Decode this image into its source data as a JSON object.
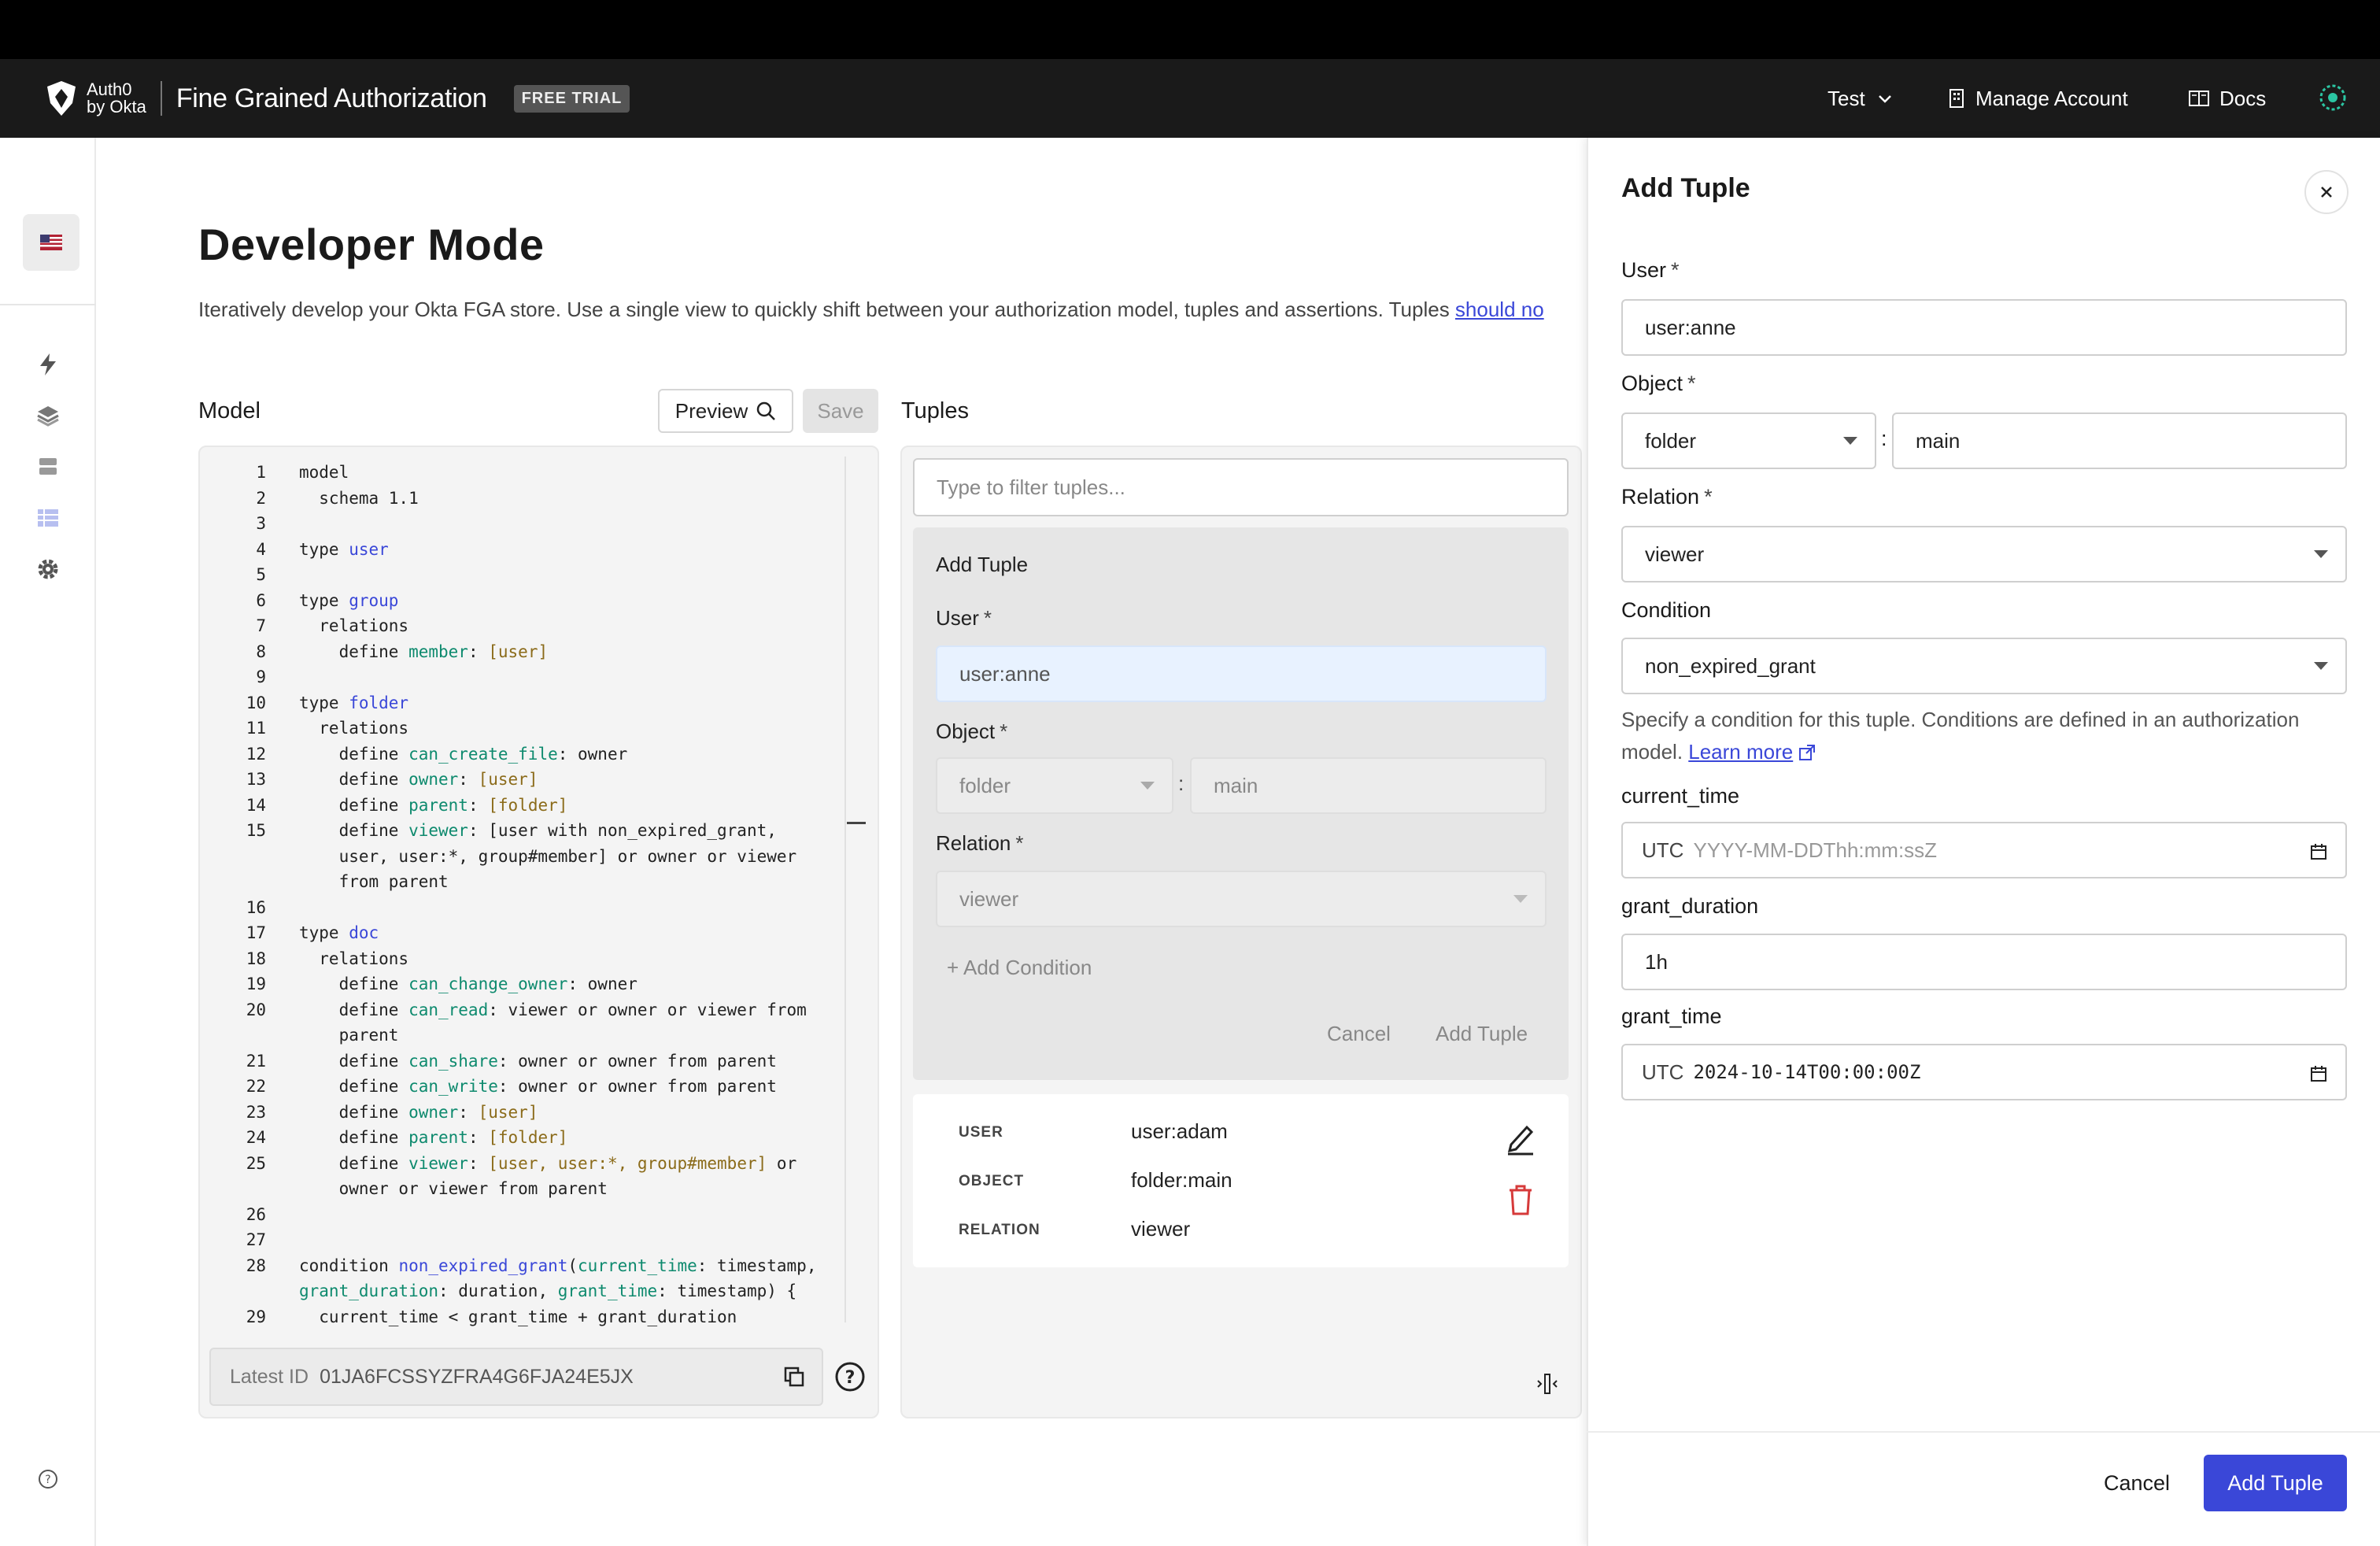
{
  "header": {
    "logo_text_top": "Auth0",
    "logo_text_bottom": "by Okta",
    "product": "Fine Grained Authorization",
    "badge": "FREE TRIAL",
    "tenant": "Test",
    "manage_account": "Manage Account",
    "docs": "Docs"
  },
  "page": {
    "title": "Developer Mode",
    "subtitle": "Iteratively develop your Okta FGA store. Use a single view to quickly shift between your authorization model, tuples and assertions. Tuples ",
    "subtitle_link": "should no"
  },
  "model": {
    "label": "Model",
    "preview": "Preview",
    "save": "Save",
    "latest_id_label": "Latest ID",
    "latest_id": "01JA6FCSSYZFRA4G6FJA24E5JX",
    "lines": [
      {
        "n": "1",
        "t": "model"
      },
      {
        "n": "2",
        "t": "  schema 1.1"
      },
      {
        "n": "3",
        "t": ""
      },
      {
        "n": "4",
        "t": "type user"
      },
      {
        "n": "5",
        "t": ""
      },
      {
        "n": "6",
        "t": "type group"
      },
      {
        "n": "7",
        "t": "  relations"
      },
      {
        "n": "8",
        "t": "    define member: [user]"
      },
      {
        "n": "9",
        "t": ""
      },
      {
        "n": "10",
        "t": "type folder"
      },
      {
        "n": "11",
        "t": "  relations"
      },
      {
        "n": "12",
        "t": "    define can_create_file: owner"
      },
      {
        "n": "13",
        "t": "    define owner: [user]"
      },
      {
        "n": "14",
        "t": "    define parent: [folder]"
      },
      {
        "n": "15",
        "t": "    define viewer: [user with non_expired_grant,"
      },
      {
        "n": "",
        "t": "    user, user:*, group#member] or owner or viewer"
      },
      {
        "n": "",
        "t": "    from parent"
      },
      {
        "n": "16",
        "t": ""
      },
      {
        "n": "17",
        "t": "type doc"
      },
      {
        "n": "18",
        "t": "  relations"
      },
      {
        "n": "19",
        "t": "    define can_change_owner: owner"
      },
      {
        "n": "20",
        "t": "    define can_read: viewer or owner or viewer from"
      },
      {
        "n": "",
        "t": "    parent"
      },
      {
        "n": "21",
        "t": "    define can_share: owner or owner from parent"
      },
      {
        "n": "22",
        "t": "    define can_write: owner or owner from parent"
      },
      {
        "n": "23",
        "t": "    define owner: [user]"
      },
      {
        "n": "24",
        "t": "    define parent: [folder]"
      },
      {
        "n": "25",
        "t": "    define viewer: [user, user:*, group#member] or"
      },
      {
        "n": "",
        "t": "    owner or viewer from parent"
      },
      {
        "n": "26",
        "t": ""
      },
      {
        "n": "27",
        "t": ""
      },
      {
        "n": "28",
        "t": "condition non_expired_grant(current_time: timestamp,"
      },
      {
        "n": "",
        "t": "grant_duration: duration, grant_time: timestamp) {"
      },
      {
        "n": "29",
        "t": "  current_time < grant_time + grant_duration"
      }
    ]
  },
  "tuples": {
    "label": "Tuples",
    "filter_placeholder": "Type to filter tuples...",
    "inline_form": {
      "title": "Add Tuple",
      "user_label": "User",
      "user_value": "user:anne",
      "object_label": "Object",
      "object_type": "folder",
      "object_id": "main",
      "relation_label": "Relation",
      "relation_value": "viewer",
      "add_condition": "+ Add Condition",
      "cancel": "Cancel",
      "submit": "Add Tuple"
    },
    "existing": {
      "user_key": "USER",
      "user_val": "user:adam",
      "object_key": "OBJECT",
      "object_val": "folder:main",
      "relation_key": "RELATION",
      "relation_val": "viewer"
    }
  },
  "drawer": {
    "title": "Add Tuple",
    "user_label": "User",
    "user_value": "user:anne",
    "object_label": "Object",
    "object_type": "folder",
    "object_id": "main",
    "relation_label": "Relation",
    "relation_value": "viewer",
    "condition_label": "Condition",
    "condition_value": "non_expired_grant",
    "hint": "Specify a condition for this tuple. Conditions are defined in an authorization model. ",
    "hint_link": "Learn more",
    "current_time_label": "current_time",
    "current_time_prefix": "UTC",
    "current_time_placeholder": "YYYY-MM-DDThh:mm:ssZ",
    "grant_duration_label": "grant_duration",
    "grant_duration_value": "1h",
    "grant_time_label": "grant_time",
    "grant_time_prefix": "UTC",
    "grant_time_value": "2024-10-14T00:00:00Z",
    "cancel": "Cancel",
    "submit": "Add Tuple",
    "required_mark": "*"
  }
}
